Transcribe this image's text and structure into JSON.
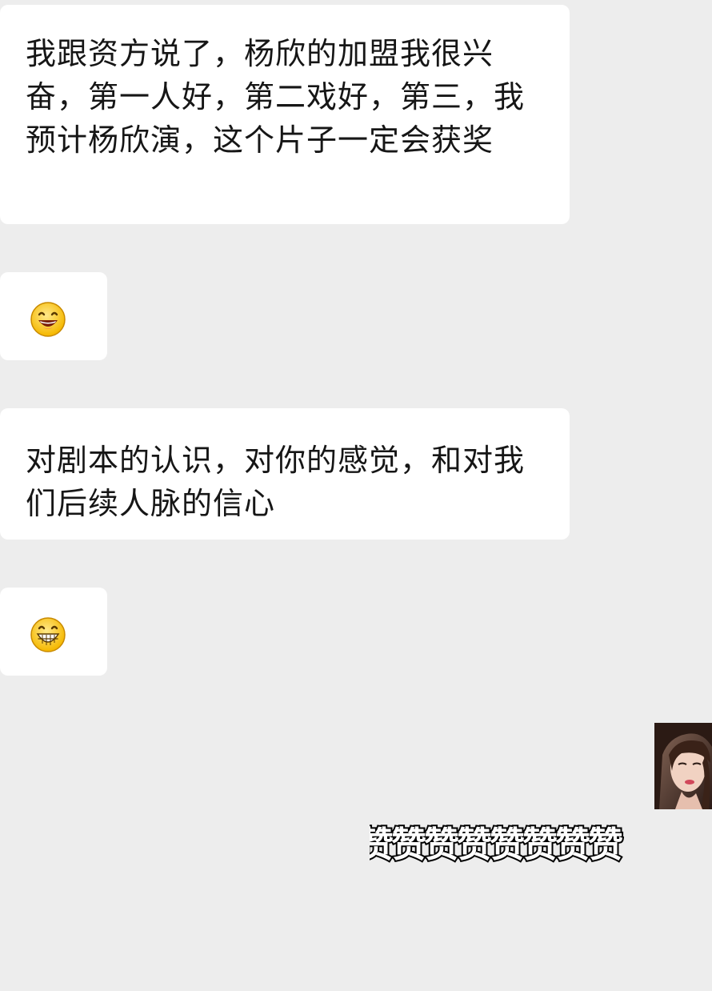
{
  "messages": [
    {
      "type": "text",
      "text": "我跟资方说了，杨欣的加盟我很兴奋，第一人好，第二戏好，第三，我预计杨欣演，这个片子一定会获奖"
    },
    {
      "type": "emoji",
      "icon": "smile-emoji"
    },
    {
      "type": "text",
      "text": "对剧本的认识，对你的感觉，和对我们后续人脉的信心"
    },
    {
      "type": "emoji",
      "icon": "grin-emoji"
    }
  ],
  "reply": {
    "avatar_icon": "contact-avatar",
    "sticker_text": "赞赞赞赞赞赞赞赞"
  },
  "colors": {
    "background": "#ededed",
    "bubble": "#ffffff",
    "text": "#161616"
  }
}
